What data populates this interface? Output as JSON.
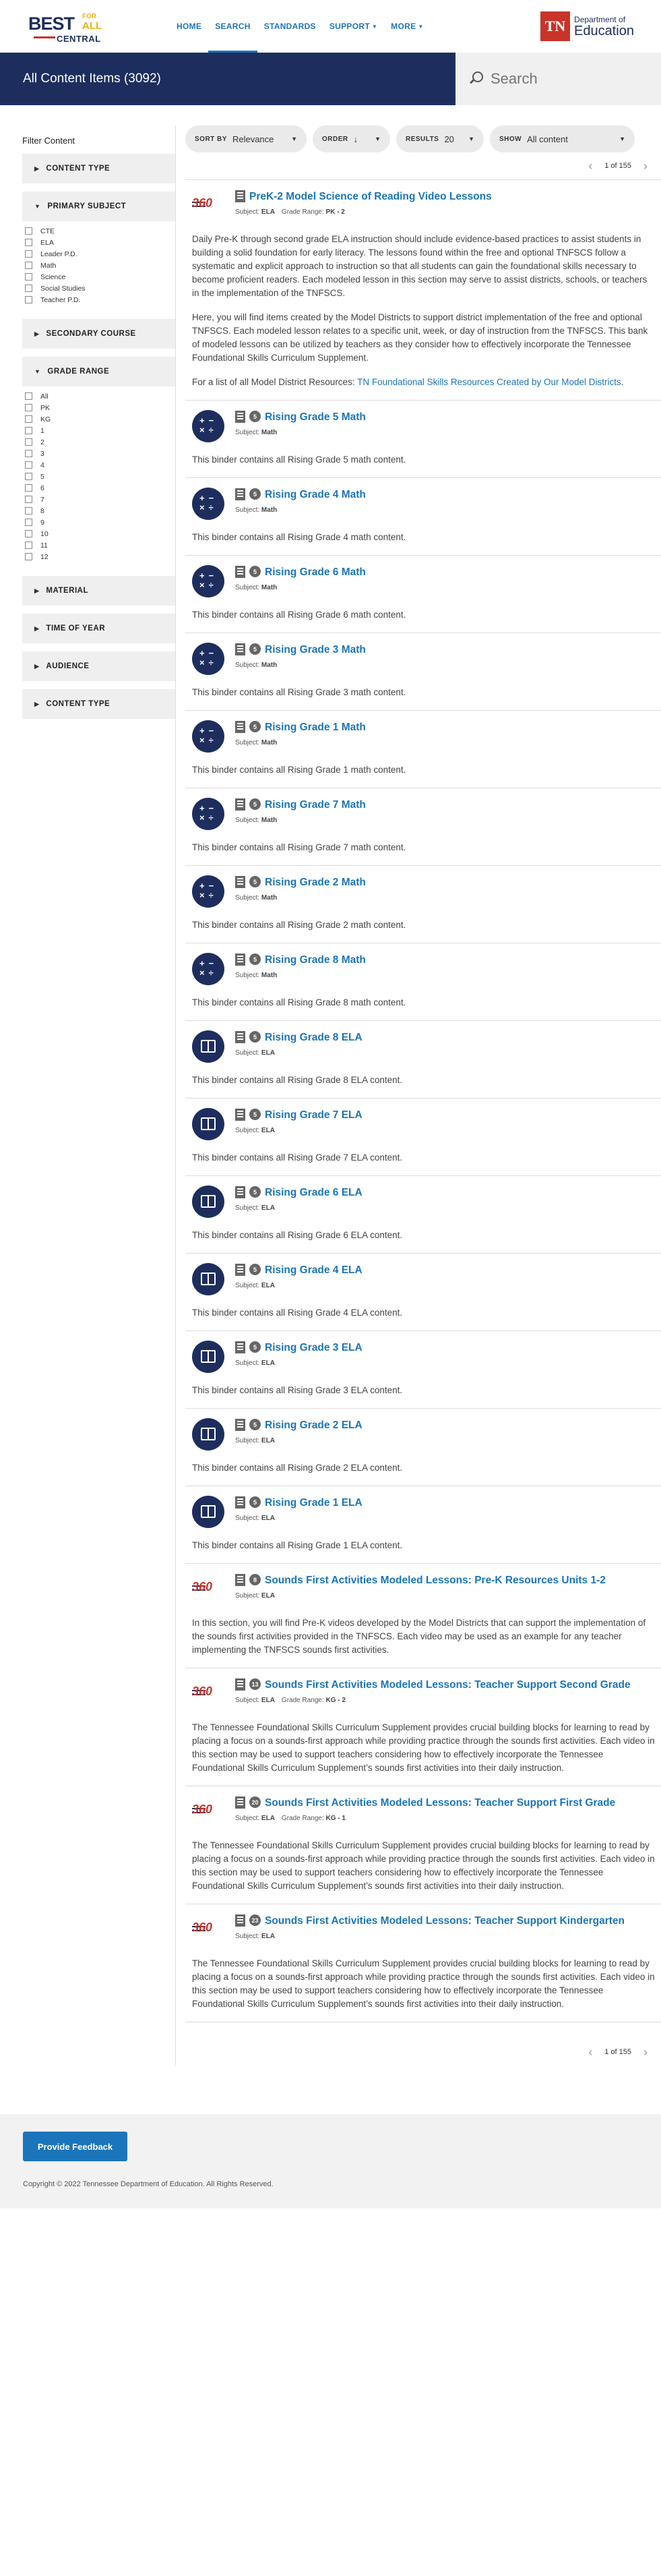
{
  "header": {
    "logo": {
      "best": "BEST",
      "for": "FOR",
      "all": "ALL",
      "central": "CENTRAL"
    },
    "nav": [
      {
        "label": "HOME"
      },
      {
        "label": "SEARCH"
      },
      {
        "label": "STANDARDS"
      },
      {
        "label": "SUPPORT"
      },
      {
        "label": "MORE"
      }
    ],
    "tn_logo": {
      "mark": "TN",
      "dept": "Department of",
      "name": "Education"
    }
  },
  "banner": {
    "title": "All Content Items (3092)",
    "search_placeholder": "Search"
  },
  "sidebar": {
    "title": "Filter Content",
    "content_type": "CONTENT TYPE",
    "primary_subject": {
      "label": "PRIMARY SUBJECT",
      "options": [
        "CTE",
        "ELA",
        "Leader P.D.",
        "Math",
        "Science",
        "Social Studies",
        "Teacher P.D."
      ]
    },
    "secondary_course": "SECONDARY COURSE",
    "grade_range": {
      "label": "GRADE RANGE",
      "options": [
        "All",
        "PK",
        "KG",
        "1",
        "2",
        "3",
        "4",
        "5",
        "6",
        "7",
        "8",
        "9",
        "10",
        "11",
        "12"
      ]
    },
    "material": "MATERIAL",
    "time_of_year": "TIME OF YEAR",
    "audience": "AUDIENCE",
    "content_type_2": "CONTENT TYPE"
  },
  "toolbar": {
    "sort": {
      "label": "SORT BY",
      "value": "Relevance"
    },
    "order": {
      "label": "ORDER",
      "value": "↓"
    },
    "results": {
      "label": "RESULTS",
      "value": "20"
    },
    "show": {
      "label": "SHOW",
      "value": "All content"
    }
  },
  "pagination": {
    "text": "1 of 155"
  },
  "items": [
    {
      "thumb": "logo360",
      "title": "PreK-2 Model Science of Reading Video Lessons",
      "count": "",
      "subject": "ELA",
      "grade_range": "PK - 2",
      "desc": [
        "Daily Pre-K through second grade ELA instruction should include evidence-based practices to assist students in building a solid foundation for early literacy. The lessons found within the free and optional TNFSCS follow a systematic and explicit approach to instruction so that all students can gain the foundational skills necessary to become proficient readers. Each modeled lesson in this section may serve to assist districts, schools, or teachers in the implementation of the TNFSCS.",
        "Here, you will find items created by the Model Districts to support district implementation of the free and optional TNFSCS. Each modeled lesson relates to a specific unit, week, or day of instruction from the TNFSCS. This bank of modeled lessons can be utilized by teachers as they consider how to effectively incorporate the Tennessee Foundational Skills Curriculum Supplement."
      ],
      "link_prefix": "For a list of all Model District Resources: ",
      "link_text": "TN Foundational Skills Resources Created by Our Model Districts",
      "link_suffix": "."
    },
    {
      "thumb": "math",
      "title": "Rising Grade 5 Math",
      "count": "5",
      "subject": "Math",
      "grade_range": "",
      "desc": [
        "This binder contains all Rising Grade 5 math content."
      ]
    },
    {
      "thumb": "math",
      "title": "Rising Grade 4 Math",
      "count": "5",
      "subject": "Math",
      "grade_range": "",
      "desc": [
        "This binder contains all Rising Grade 4 math content."
      ]
    },
    {
      "thumb": "math",
      "title": "Rising Grade 6 Math",
      "count": "5",
      "subject": "Math",
      "grade_range": "",
      "desc": [
        "This binder contains all Rising Grade 6 math content."
      ]
    },
    {
      "thumb": "math",
      "title": "Rising Grade 3 Math",
      "count": "5",
      "subject": "Math",
      "grade_range": "",
      "desc": [
        "This binder contains all Rising Grade 3 math content."
      ]
    },
    {
      "thumb": "math",
      "title": "Rising Grade 1 Math",
      "count": "5",
      "subject": "Math",
      "grade_range": "",
      "desc": [
        "This binder contains all Rising Grade 1 math content."
      ]
    },
    {
      "thumb": "math",
      "title": "Rising Grade 7 Math",
      "count": "5",
      "subject": "Math",
      "grade_range": "",
      "desc": [
        "This binder contains all Rising Grade 7 math content."
      ]
    },
    {
      "thumb": "math",
      "title": "Rising Grade 2 Math",
      "count": "5",
      "subject": "Math",
      "grade_range": "",
      "desc": [
        "This binder contains all Rising Grade 2 math content."
      ]
    },
    {
      "thumb": "math",
      "title": "Rising Grade 8 Math",
      "count": "5",
      "subject": "Math",
      "grade_range": "",
      "desc": [
        "This binder contains all Rising Grade 8 math content."
      ]
    },
    {
      "thumb": "ela",
      "title": "Rising Grade 8 ELA",
      "count": "5",
      "subject": "ELA",
      "grade_range": "",
      "desc": [
        "This binder contains all Rising Grade 8 ELA content."
      ]
    },
    {
      "thumb": "ela",
      "title": "Rising Grade 7 ELA",
      "count": "5",
      "subject": "ELA",
      "grade_range": "",
      "desc": [
        "This binder contains all Rising Grade 7 ELA content."
      ]
    },
    {
      "thumb": "ela",
      "title": "Rising Grade 6 ELA",
      "count": "5",
      "subject": "ELA",
      "grade_range": "",
      "desc": [
        "This binder contains all Rising Grade 6 ELA content."
      ]
    },
    {
      "thumb": "ela",
      "title": "Rising Grade 4 ELA",
      "count": "5",
      "subject": "ELA",
      "grade_range": "",
      "desc": [
        "This binder contains all Rising Grade 4 ELA content."
      ]
    },
    {
      "thumb": "ela",
      "title": "Rising Grade 3 ELA",
      "count": "5",
      "subject": "ELA",
      "grade_range": "",
      "desc": [
        "This binder contains all Rising Grade 3 ELA content."
      ]
    },
    {
      "thumb": "ela",
      "title": "Rising Grade 2 ELA",
      "count": "5",
      "subject": "ELA",
      "grade_range": "",
      "desc": [
        "This binder contains all Rising Grade 2 ELA content."
      ]
    },
    {
      "thumb": "ela",
      "title": "Rising Grade 1 ELA",
      "count": "5",
      "subject": "ELA",
      "grade_range": "",
      "desc": [
        "This binder contains all Rising Grade 1 ELA content."
      ]
    },
    {
      "thumb": "logo360",
      "title": "Sounds First Activities Modeled Lessons: Pre-K Resources Units 1-2",
      "count": "8",
      "subject": "ELA",
      "grade_range": "",
      "desc": [
        "In this section, you will find Pre-K videos developed by the Model Districts that can support the implementation of the sounds first activities provided in the TNFSCS. Each video may be used as an example for any teacher implementing the TNFSCS sounds first activities."
      ]
    },
    {
      "thumb": "logo360",
      "title": "Sounds First Activities Modeled Lessons: Teacher Support Second Grade",
      "count": "13",
      "subject": "ELA",
      "grade_range": "KG - 2",
      "desc": [
        "The Tennessee Foundational Skills Curriculum Supplement provides crucial building blocks for learning to read by placing a focus on a sounds-first approach while providing practice through the sounds first activities. Each video in this section may be used to support teachers considering how to effectively incorporate the Tennessee Foundational Skills Curriculum Supplement’s sounds first activities into their daily instruction."
      ]
    },
    {
      "thumb": "logo360",
      "title": "Sounds First Activities Modeled Lessons: Teacher Support First Grade",
      "count": "20",
      "subject": "ELA",
      "grade_range": "KG - 1",
      "desc": [
        "The Tennessee Foundational Skills Curriculum Supplement provides crucial building blocks for learning to read by placing a focus on a sounds-first approach while providing practice through the sounds first activities. Each video in this section may be used to support teachers considering how to effectively incorporate the Tennessee Foundational Skills Curriculum Supplement’s sounds first activities into their daily instruction."
      ]
    },
    {
      "thumb": "logo360",
      "title": "Sounds First Activities Modeled Lessons: Teacher Support Kindergarten",
      "count": "23",
      "subject": "ELA",
      "grade_range": "",
      "desc": [
        "The Tennessee Foundational Skills Curriculum Supplement provides crucial building blocks for learning to read by placing a focus on a sounds-first approach while providing practice through the sounds first activities. Each video in this section may be used to support teachers considering how to effectively incorporate the Tennessee Foundational Skills Curriculum Supplement’s sounds first activities into their daily instruction."
      ]
    }
  ],
  "labels": {
    "subject": "Subject:",
    "grade_range": "Grade Range:"
  },
  "footer": {
    "feedback_button": "Provide Feedback",
    "copyright": "Copyright © 2022 Tennessee Department of Education. All Rights Reserved."
  }
}
